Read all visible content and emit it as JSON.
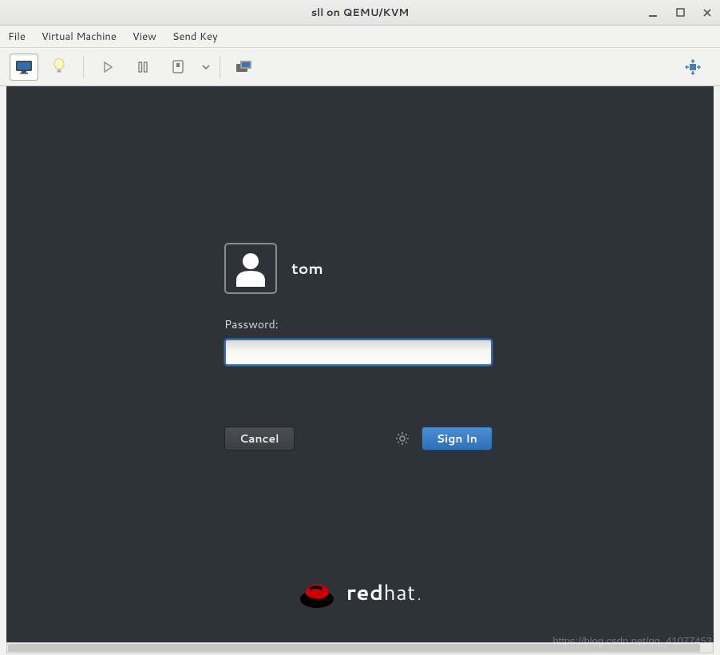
{
  "window": {
    "title": "sll on QEMU/KVM"
  },
  "menubar": {
    "file": "File",
    "virtual_machine": "Virtual Machine",
    "view": "View",
    "send_key": "Send Key"
  },
  "toolbar": {
    "console_icon": "console-icon",
    "info_icon": "lightbulb-icon",
    "play_icon": "play-icon",
    "pause_icon": "pause-icon",
    "power_icon": "shutdown-icon",
    "snapshot_icon": "snapshots-icon",
    "fullscreen_icon": "fullscreen-icon"
  },
  "login": {
    "username": "tom",
    "password_label": "Password:",
    "password_value": "",
    "cancel_label": "Cancel",
    "signin_label": "Sign In"
  },
  "branding": {
    "bold": "red",
    "light": "hat",
    "dot": "."
  },
  "watermark": "https://blog.csdn.net/qq_41077453"
}
